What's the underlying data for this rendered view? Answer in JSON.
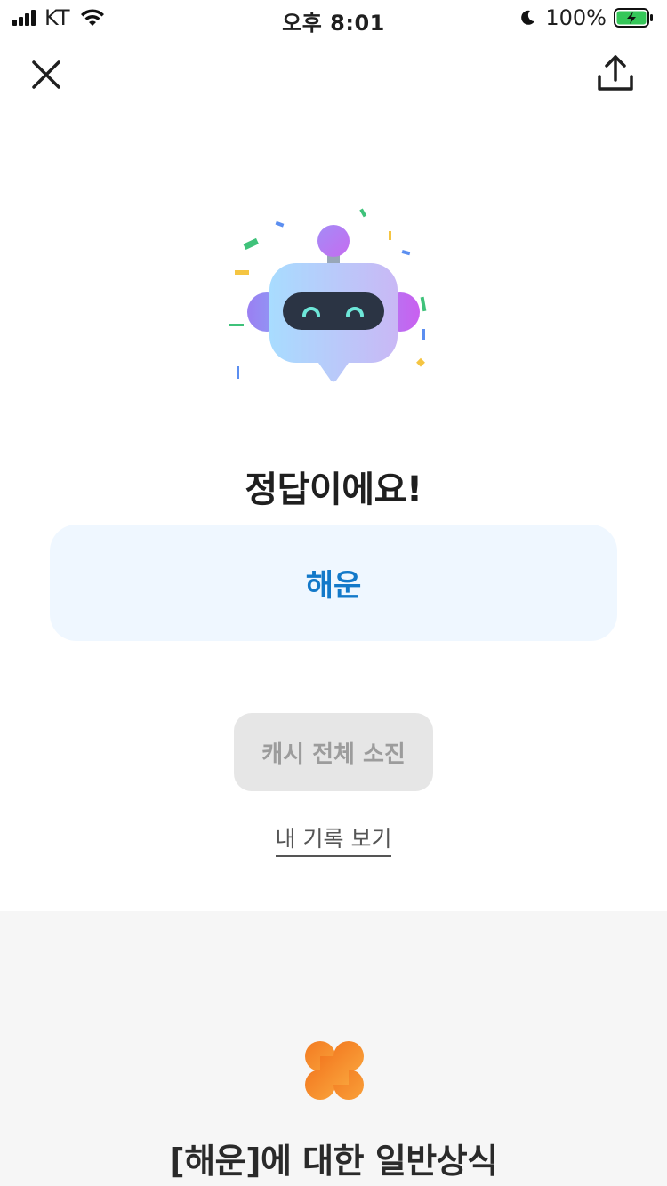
{
  "status_bar": {
    "carrier": "KT",
    "time": "오후 8:01",
    "battery": "100%"
  },
  "nav": {
    "close_icon": "close-icon",
    "share_icon": "share-icon"
  },
  "result": {
    "title": "정답이에요!",
    "answer": "해운"
  },
  "actions": {
    "cash_button": "캐시 전체 소진",
    "history_link": "내 기록 보기"
  },
  "info": {
    "icon": "clover-icon",
    "title": "[해운]에 대한 일반상식"
  },
  "colors": {
    "answer_bg": "#eff7ff",
    "answer_text": "#1379c9",
    "button_bg": "#e6e6e6",
    "info_bg": "#f6f6f6",
    "clover": "#f07f25"
  }
}
